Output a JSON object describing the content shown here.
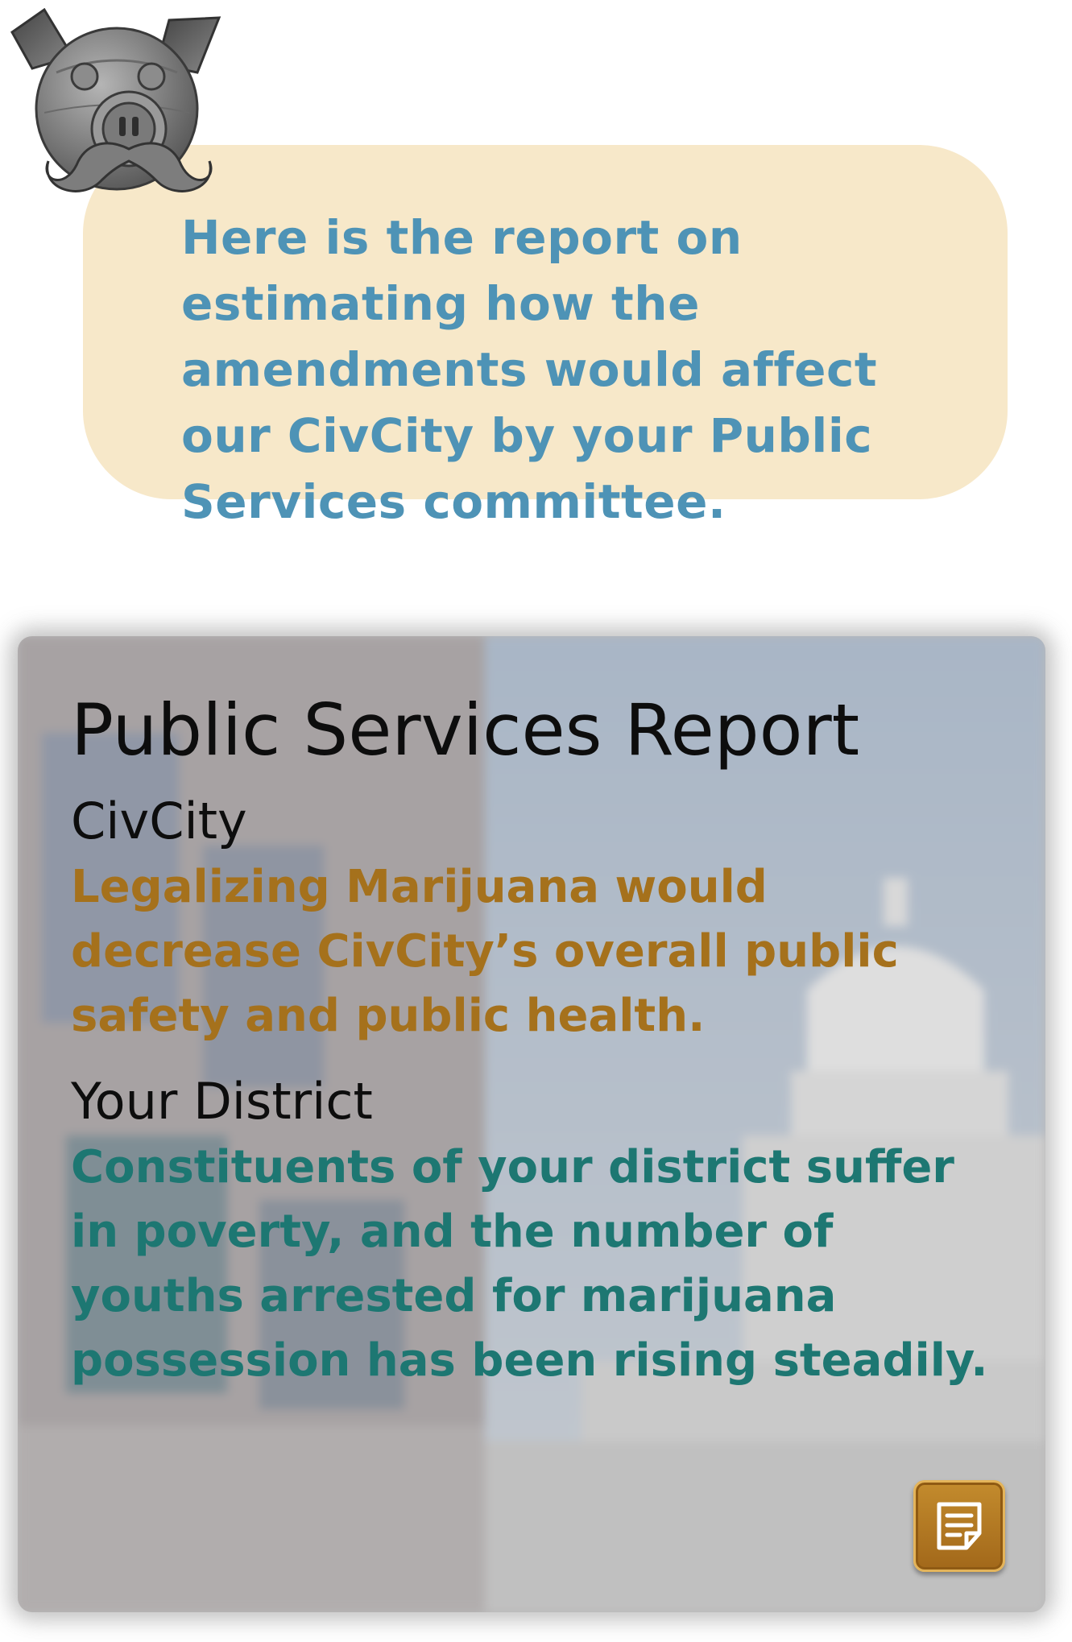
{
  "dialog": {
    "speaker_icon": "robot-pig-mascot-icon",
    "message": "Here is the report on estimating how the amendments would affect our CivCity by your Public Services committee."
  },
  "report": {
    "title": "Public Services Report",
    "civcity": {
      "heading": "CivCity",
      "text": "Legalizing Marijuana would decrease CivCity’s overall public safety and public health."
    },
    "district": {
      "heading": "Your District",
      "text": "Constituents of your district suffer in poverty, and the number of youths arrested for marijuana possession has been rising steadily."
    },
    "background_image": "capitol-building-blurred",
    "notes_button_icon": "notes-icon"
  },
  "colors": {
    "bubble_bg": "#f7e8c9",
    "bubble_text": "#4e93b6",
    "civcity_text": "#a5711c",
    "district_text": "#1d7772",
    "notes_button": "#b27a22"
  }
}
